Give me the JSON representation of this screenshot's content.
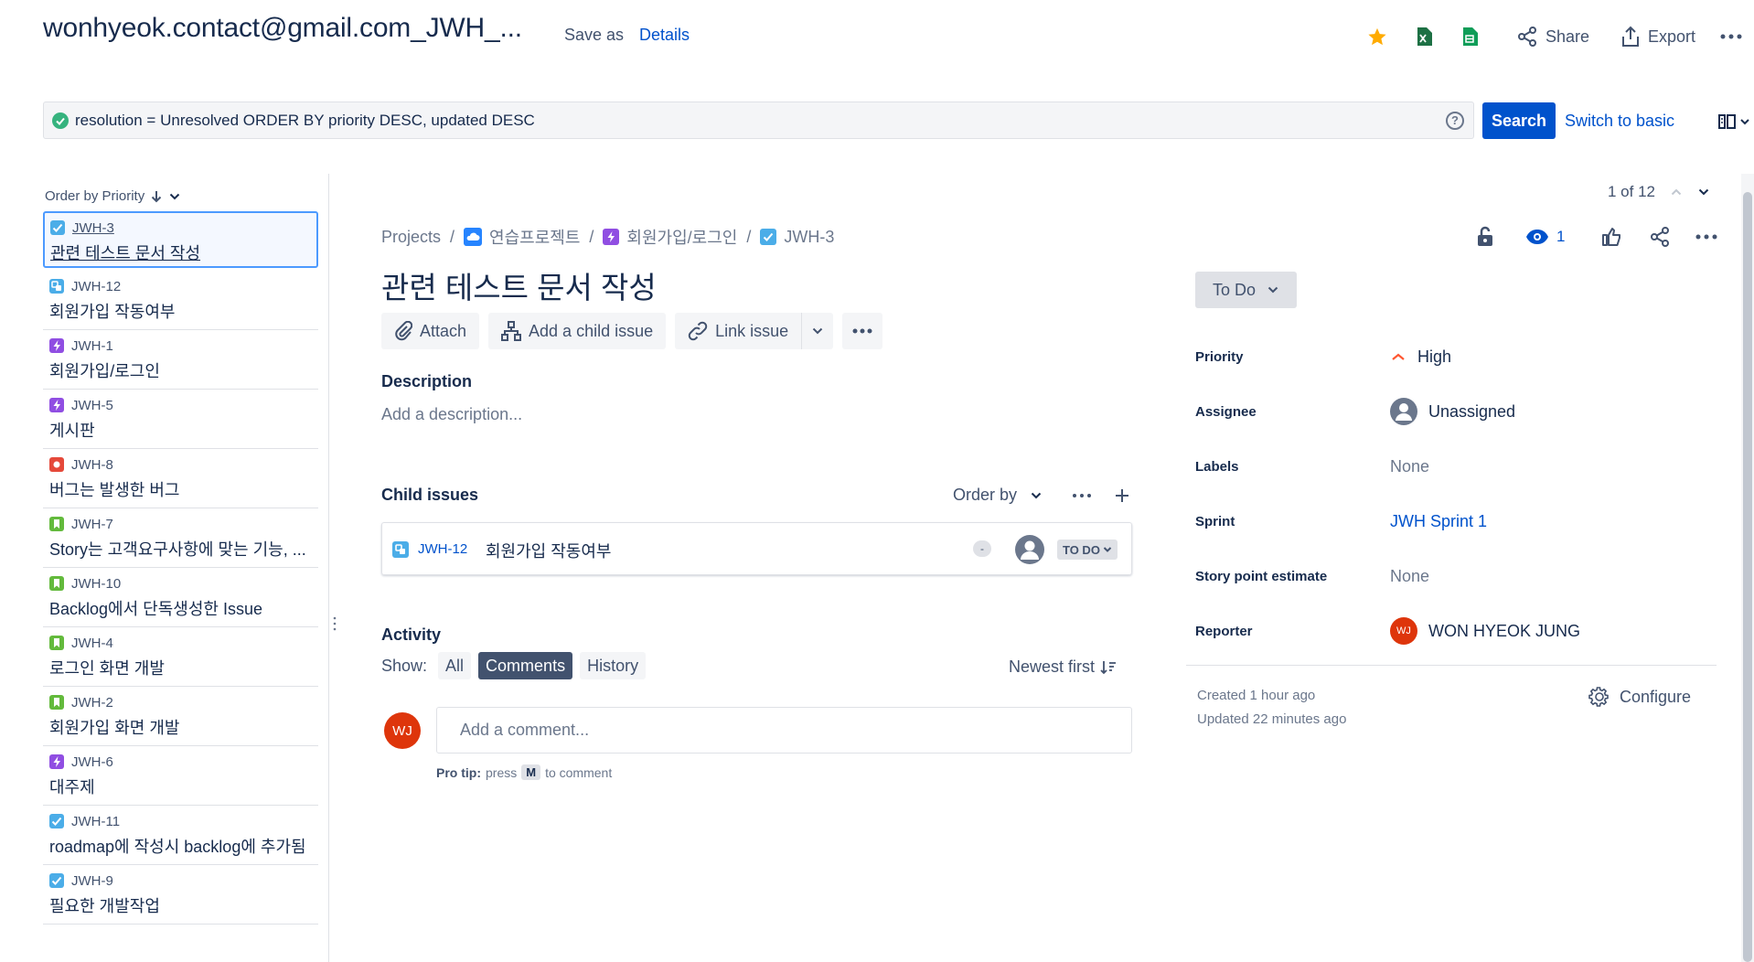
{
  "header": {
    "filter_title": "wonhyeok.contact@gmail.com_JWH_...",
    "save_as": "Save as",
    "details": "Details",
    "share": "Share",
    "export": "Export"
  },
  "search": {
    "jql": "resolution = Unresolved ORDER BY priority DESC, updated DESC",
    "search_label": "Search",
    "switch_label": "Switch to basic",
    "help_glyph": "?"
  },
  "list": {
    "order_label": "Order by Priority",
    "items": [
      {
        "key": "JWH-3",
        "summary": "관련 테스트 문서 작성",
        "type": "task"
      },
      {
        "key": "JWH-12",
        "summary": "회원가입 작동여부",
        "type": "subtask"
      },
      {
        "key": "JWH-1",
        "summary": "회원가입/로그인",
        "type": "epic"
      },
      {
        "key": "JWH-5",
        "summary": "게시판",
        "type": "epic"
      },
      {
        "key": "JWH-8",
        "summary": "버그는 발생한 버그",
        "type": "bug"
      },
      {
        "key": "JWH-7",
        "summary": "Story는 고객요구사항에 맞는 기능, ...",
        "type": "story"
      },
      {
        "key": "JWH-10",
        "summary": "Backlog에서 단독생성한 Issue",
        "type": "story"
      },
      {
        "key": "JWH-4",
        "summary": "로그인 화면 개발",
        "type": "story"
      },
      {
        "key": "JWH-2",
        "summary": "회원가입 화면 개발",
        "type": "story"
      },
      {
        "key": "JWH-6",
        "summary": "대주제",
        "type": "epic"
      },
      {
        "key": "JWH-11",
        "summary": "roadmap에 작성시 backlog에 추가됨",
        "type": "task"
      },
      {
        "key": "JWH-9",
        "summary": "필요한 개발작업",
        "type": "task"
      }
    ]
  },
  "pager": {
    "text": "1 of 12"
  },
  "breadcrumb": {
    "projects": "Projects",
    "project": "연습프로젝트",
    "epic": "회원가입/로그인",
    "issue": "JWH-3"
  },
  "issue": {
    "watchers": "1",
    "title": "관련 테스트 문서 작성",
    "actions": {
      "attach": "Attach",
      "add_child": "Add a child issue",
      "link": "Link issue"
    },
    "description_label": "Description",
    "description_placeholder": "Add a description...",
    "child_label": "Child issues",
    "child_order_by": "Order by",
    "children": [
      {
        "key": "JWH-12",
        "summary": "회원가입 작동여부",
        "priority": "-",
        "status": "TO DO"
      }
    ],
    "activity_label": "Activity",
    "show_label": "Show:",
    "show_options": [
      "All",
      "Comments",
      "History"
    ],
    "show_active": "Comments",
    "sort_label": "Newest first",
    "comment_placeholder": "Add a comment...",
    "user_initials": "WJ",
    "pro_tip_label": "Pro tip:",
    "pro_tip_press": "press",
    "pro_tip_key": "M",
    "pro_tip_end": "to comment"
  },
  "details_panel": {
    "status": "To Do",
    "fields": [
      {
        "label": "Priority",
        "value": "High"
      },
      {
        "label": "Assignee",
        "value": "Unassigned"
      },
      {
        "label": "Labels",
        "value": "None"
      },
      {
        "label": "Sprint",
        "value": "JWH Sprint 1"
      },
      {
        "label": "Story point estimate",
        "value": "None"
      },
      {
        "label": "Reporter",
        "value": "WON HYEOK JUNG",
        "initials": "WJ"
      }
    ],
    "created": "Created 1 hour ago",
    "updated": "Updated 22 minutes ago",
    "configure": "Configure"
  },
  "colors": {
    "primary": "#0052cc",
    "text": "#172b4d",
    "subtle": "#42526e",
    "priority_high": "#ff5630",
    "star": "#ffab00",
    "avatar": "#de350b"
  }
}
